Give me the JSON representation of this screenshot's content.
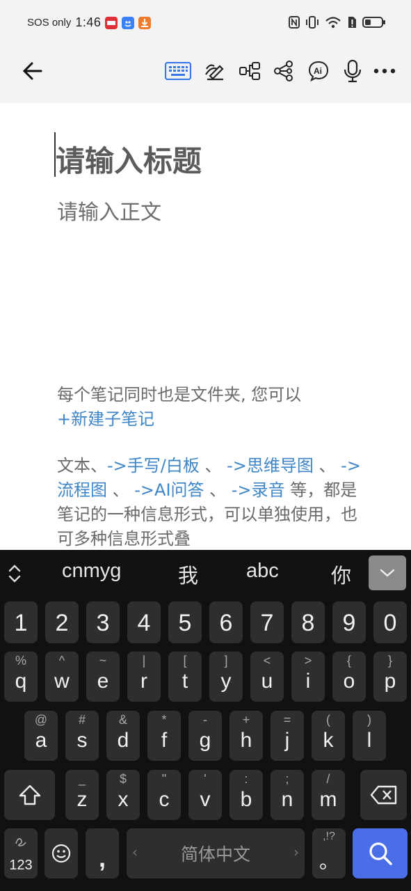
{
  "status_bar": {
    "carrier": "SOS only",
    "time": "1:46"
  },
  "toolbar": {
    "back": "back-arrow-icon",
    "icons": [
      "keyboard-icon",
      "handwriting-icon",
      "flowchart-icon",
      "mindmap-icon",
      "ai-chat-icon",
      "microphone-icon",
      "more-icon"
    ],
    "ai_label": "Ai",
    "active_color": "#3b78e7"
  },
  "editor": {
    "title_placeholder": "请输入标题",
    "body_placeholder": "请输入正文",
    "help": {
      "p1_text": "每个笔记同时也是文件夹, 您可以",
      "p1_link": "+新建子笔记",
      "p2_text1": "文本、",
      "p2_link1": "->手写/白板",
      "p2_sep1": " 、 ",
      "p2_link2": "->思维导图",
      "p2_sep2": " 、 ",
      "p2_link3": "->流程图",
      "p2_sep3": " 、 ",
      "p2_link4": "->AI问答",
      "p2_sep4": " 、 ",
      "p2_link5": "->录音",
      "p2_text2": " 等，都是笔记的一种信息形式，可以单独使用，也可多种信息形式叠"
    }
  },
  "keyboard": {
    "candidates": [
      "cnmyg",
      "我",
      "abc",
      "你"
    ],
    "numbers": [
      "1",
      "2",
      "3",
      "4",
      "5",
      "6",
      "7",
      "8",
      "9",
      "0"
    ],
    "row1": [
      {
        "k": "q",
        "s": "%"
      },
      {
        "k": "w",
        "s": "^"
      },
      {
        "k": "e",
        "s": "~"
      },
      {
        "k": "r",
        "s": "|"
      },
      {
        "k": "t",
        "s": "["
      },
      {
        "k": "y",
        "s": "]"
      },
      {
        "k": "u",
        "s": "<"
      },
      {
        "k": "i",
        "s": ">"
      },
      {
        "k": "o",
        "s": "{"
      },
      {
        "k": "p",
        "s": "}"
      }
    ],
    "row2": [
      {
        "k": "a",
        "s": "@"
      },
      {
        "k": "s",
        "s": "#"
      },
      {
        "k": "d",
        "s": "&"
      },
      {
        "k": "f",
        "s": "*"
      },
      {
        "k": "g",
        "s": "-"
      },
      {
        "k": "h",
        "s": "+"
      },
      {
        "k": "j",
        "s": "="
      },
      {
        "k": "k",
        "s": "("
      },
      {
        "k": "l",
        "s": ")"
      }
    ],
    "row3": [
      {
        "k": "z",
        "s": "_"
      },
      {
        "k": "x",
        "s": "$"
      },
      {
        "k": "c",
        "s": "\""
      },
      {
        "k": "v",
        "s": "'"
      },
      {
        "k": "b",
        "s": ":"
      },
      {
        "k": "n",
        "s": ";"
      },
      {
        "k": "m",
        "s": "/"
      }
    ],
    "num_switch": "123",
    "comma": ",",
    "space_label": "简体中文",
    "period_sub": ",!?",
    "period": "。",
    "search_color": "#4a6ee8"
  }
}
